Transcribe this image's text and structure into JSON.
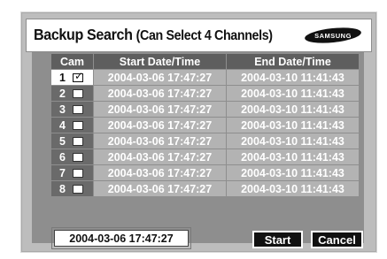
{
  "header": {
    "title_main": "Backup Search",
    "title_paren": "(Can Select 4 Channels)",
    "logo_text": "SAMSUNG"
  },
  "table": {
    "columns": [
      "Cam",
      "Start Date/Time",
      "End Date/Time"
    ],
    "rows": [
      {
        "cam": "1",
        "checked": true,
        "start": "2004-03-06  17:47:27",
        "end": "2004-03-10  11:41:43"
      },
      {
        "cam": "2",
        "checked": false,
        "start": "2004-03-06  17:47:27",
        "end": "2004-03-10  11:41:43"
      },
      {
        "cam": "3",
        "checked": false,
        "start": "2004-03-06  17:47:27",
        "end": "2004-03-10  11:41:43"
      },
      {
        "cam": "4",
        "checked": false,
        "start": "2004-03-06  17:47:27",
        "end": "2004-03-10  11:41:43"
      },
      {
        "cam": "5",
        "checked": false,
        "start": "2004-03-06  17:47:27",
        "end": "2004-03-10  11:41:43"
      },
      {
        "cam": "6",
        "checked": false,
        "start": "2004-03-06  17:47:27",
        "end": "2004-03-10  11:41:43"
      },
      {
        "cam": "7",
        "checked": false,
        "start": "2004-03-06  17:47:27",
        "end": "2004-03-10  11:41:43"
      },
      {
        "cam": "8",
        "checked": false,
        "start": "2004-03-06  17:47:27",
        "end": "2004-03-10  11:41:43"
      }
    ]
  },
  "footer": {
    "date_value": "2004-03-06  17:47:27",
    "start_label": "Start",
    "cancel_label": "Cancel"
  }
}
